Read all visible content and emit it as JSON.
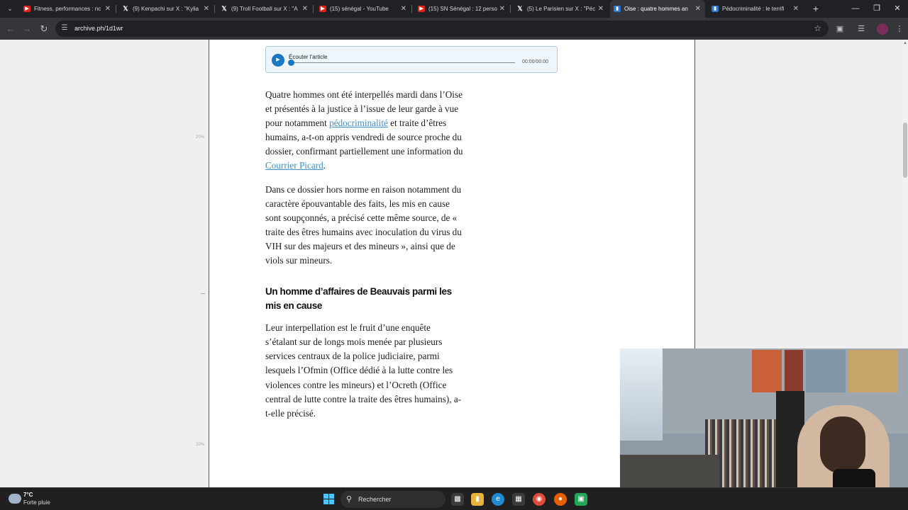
{
  "browser": {
    "tabs": [
      {
        "title": "Fitness, performances : nc",
        "icon": "youtube-icon",
        "active": false
      },
      {
        "title": "(9) Kenpachi sur X : \"Kylia",
        "icon": "x-icon",
        "active": false
      },
      {
        "title": "(9) Troll Football sur X : \"A",
        "icon": "x-icon",
        "active": false
      },
      {
        "title": "(15) sénégal - YouTube",
        "icon": "youtube-icon",
        "active": false
      },
      {
        "title": "(15) SN Sénégal : 12 perso",
        "icon": "youtube-icon",
        "active": false
      },
      {
        "title": "(5) Le Parisien sur X : \"Péc",
        "icon": "x-icon",
        "active": false
      },
      {
        "title": "Oise : quatre hommes an",
        "icon": "archive-icon",
        "active": true
      },
      {
        "title": "Pédocriminalité : le terrifi",
        "icon": "archive-icon",
        "active": false
      }
    ],
    "url": "archive.ph/1d1wr"
  },
  "audio_player": {
    "label": "Écouter l'article",
    "time": "00:00/00:00"
  },
  "ruler": {
    "mark_top": "20%",
    "mark_bottom": "20%"
  },
  "article": {
    "p1": {
      "before": "Quatre hommes ont été interpellés mardi dans l’Oise et présentés à la justice à l’issue de leur garde à vue pour notamment ",
      "link": "pédocriminalité",
      "after": " et traite d’êtres humains, a-t-on appris vendredi de source proche du dossier, confirmant partiellement une information du "
    },
    "p1_link2": "Courrier Picard",
    "p1_end": ".",
    "p2": "Dans ce dossier hors norme en raison notamment du caractère épouvantable des faits, les mis en cause sont soupçonnés, a précisé cette même source, de « traite des êtres humains avec inoculation du virus du VIH sur des majeurs et des mineurs », ainsi que de viols sur mineurs.",
    "h2": "Un homme d’affaires de Beauvais parmi les mis en cause",
    "p3": "Leur interpellation est le fruit d’une enquête s’étalant sur de longs mois menée par plusieurs services centraux de la police judiciaire, parmi lesquels l’Ofmin (Office dédié à la lutte contre les violences contre les mineurs) et l’Ocreth (Office central de lutte contre la traite des êtres humains), a-t-elle précisé."
  },
  "taskbar": {
    "weather_temp": "7°C",
    "weather_desc": "Forte pluie",
    "search_label": "Rechercher"
  }
}
